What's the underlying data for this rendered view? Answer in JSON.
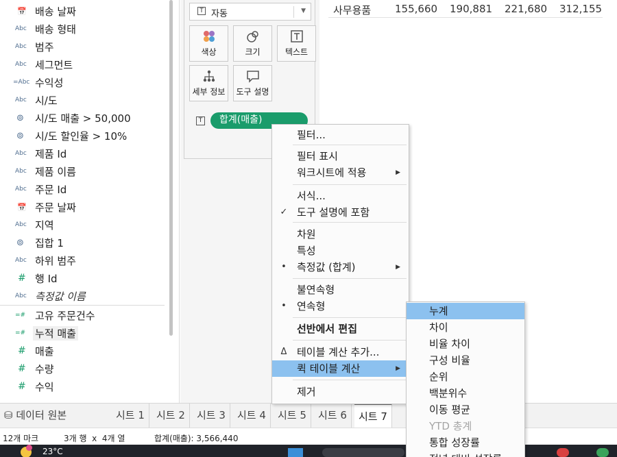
{
  "data_pane": {
    "fields": [
      {
        "icon": "calendar",
        "label": "배송 날짜"
      },
      {
        "icon": "abc",
        "label": "배송 형태"
      },
      {
        "icon": "abc",
        "label": "범주"
      },
      {
        "icon": "abc",
        "label": "세그먼트"
      },
      {
        "icon": "abc-calc",
        "label": "수익성"
      },
      {
        "icon": "abc",
        "label": "시/도"
      },
      {
        "icon": "set",
        "label": "시/도 매출 > 50,000"
      },
      {
        "icon": "set",
        "label": "시/도 할인율 > 10%"
      },
      {
        "icon": "abc",
        "label": "제품 Id"
      },
      {
        "icon": "abc",
        "label": "제품 이름"
      },
      {
        "icon": "abc",
        "label": "주문 Id"
      },
      {
        "icon": "calendar",
        "label": "주문 날짜"
      },
      {
        "icon": "abc",
        "label": "지역"
      },
      {
        "icon": "set",
        "label": "집합 1"
      },
      {
        "icon": "abc",
        "label": "하위 범주"
      },
      {
        "icon": "hash",
        "label": "행 Id"
      },
      {
        "icon": "abc",
        "label": "측정값 이름"
      },
      {
        "icon": "hash-calc",
        "label": "고유 주문건수"
      },
      {
        "icon": "hash-calc",
        "label": "누적 매출"
      },
      {
        "icon": "hash",
        "label": "매출"
      },
      {
        "icon": "hash",
        "label": "수량"
      },
      {
        "icon": "hash",
        "label": "수익"
      }
    ],
    "abc_text": "Abc",
    "abc_calc_text": "=Abc",
    "hash_text": "#",
    "hash_calc_text": "=#",
    "calendar_text": "📅",
    "set_text": "⊚"
  },
  "marks": {
    "mark_type": "자동",
    "buttons": [
      {
        "label": "색상",
        "icon": "color-icon"
      },
      {
        "label": "크기",
        "icon": "size-icon"
      },
      {
        "label": "텍스트",
        "icon": "text-icon"
      },
      {
        "label": "세부 정보",
        "icon": "detail-icon"
      },
      {
        "label": "도구 설명",
        "icon": "tooltip-icon"
      }
    ],
    "pill_label": "합계(매출)",
    "t_glyph": "T"
  },
  "view": {
    "row_label": "사무용품",
    "values": [
      "155,660",
      "190,881",
      "221,680",
      "312,155"
    ]
  },
  "context_menu": {
    "items": [
      {
        "label": "필터...",
        "mark": "",
        "submenu": false
      },
      {
        "label": "필터 표시",
        "mark": "",
        "submenu": false
      },
      {
        "label": "워크시트에 적용",
        "mark": "",
        "submenu": true
      },
      {
        "label": "서식...",
        "mark": "",
        "submenu": false
      },
      {
        "label": "도구 설명에 포함",
        "mark": "✓",
        "submenu": false
      },
      {
        "label": "차원",
        "mark": "",
        "submenu": false
      },
      {
        "label": "특성",
        "mark": "",
        "submenu": false
      },
      {
        "label": "측정값 (합계)",
        "mark": "•",
        "submenu": true
      },
      {
        "label": "불연속형",
        "mark": "",
        "submenu": false
      },
      {
        "label": "연속형",
        "mark": "•",
        "submenu": false
      },
      {
        "label": "선반에서 편집",
        "mark": "",
        "submenu": false
      },
      {
        "label": "테이블 계산 추가...",
        "mark": "Δ",
        "submenu": false
      },
      {
        "label": "퀵 테이블 계산",
        "mark": "",
        "submenu": true
      },
      {
        "label": "제거",
        "mark": "",
        "submenu": false
      }
    ]
  },
  "quick_table_calc_menu": {
    "items": [
      "누계",
      "차이",
      "비율 차이",
      "구성 비율",
      "순위",
      "백분위수",
      "이동 평균",
      "YTD 총계",
      "통합 성장률",
      "전년 대비 성장률"
    ]
  },
  "tabs": {
    "data_source": "데이터 원본",
    "sheets": [
      "시트 1",
      "시트 2",
      "시트 3",
      "시트 4",
      "시트 5",
      "시트 6",
      "시트 7"
    ],
    "active": "시트 7",
    "data_source_icon": "⛁"
  },
  "status": {
    "marks": "12개 마크",
    "rows_cols": "3개 행  x  4개 열",
    "sum": "합계(매출): 3,566,440"
  },
  "taskbar": {
    "temperature": "23°C"
  },
  "colors": {
    "pill_green": "#1a9c6b",
    "menu_highlight": "#8cc1ef"
  }
}
